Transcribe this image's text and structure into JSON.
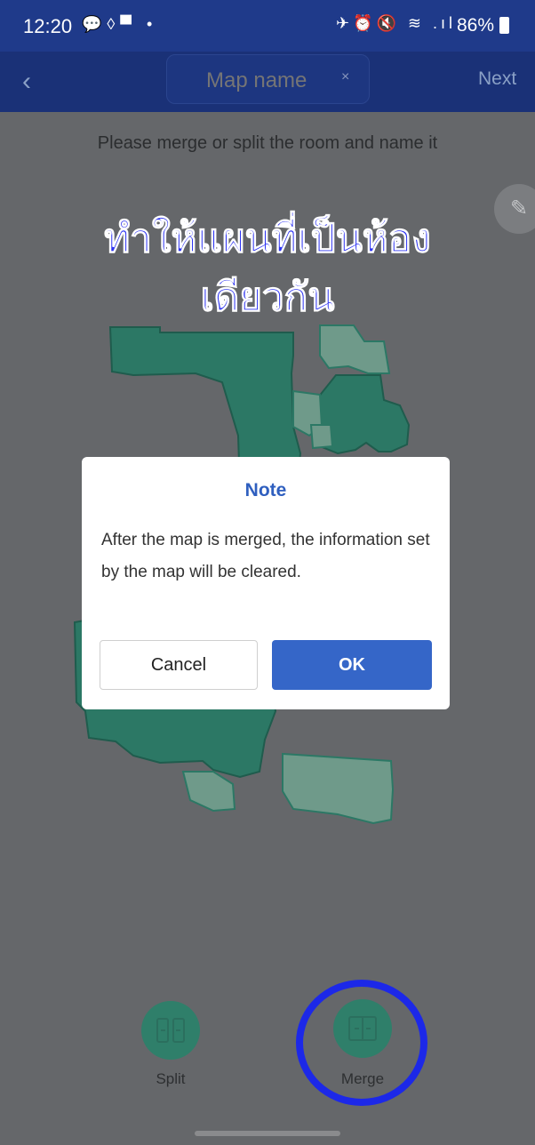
{
  "status_bar": {
    "time": "12:20",
    "left_icons": "💬◊▀ •",
    "right_icons": "✈⏰🔇 ≋ .ıl",
    "battery": "86%"
  },
  "nav": {
    "back_icon": "chevron-left-icon",
    "map_name_placeholder": "Map name",
    "clear_icon": "×",
    "next_label": "Next"
  },
  "instruction": "Please merge or split the room and name it",
  "overlay_caption": {
    "line1": "ทำให้แผนที่เป็นห้อง",
    "line2": "เดียวกัน"
  },
  "dialog": {
    "title": "Note",
    "body": "After the map is merged, the information set by the map will be cleared.",
    "cancel_label": "Cancel",
    "ok_label": "OK"
  },
  "tools": {
    "split_label": "Split",
    "merge_label": "Merge"
  },
  "colors": {
    "nav_bg": "#1a3177",
    "room_dark": "#2c7865",
    "room_light": "#6f9a8a",
    "ok_button": "#3566c8",
    "highlight_ring": "#1c28e8"
  }
}
